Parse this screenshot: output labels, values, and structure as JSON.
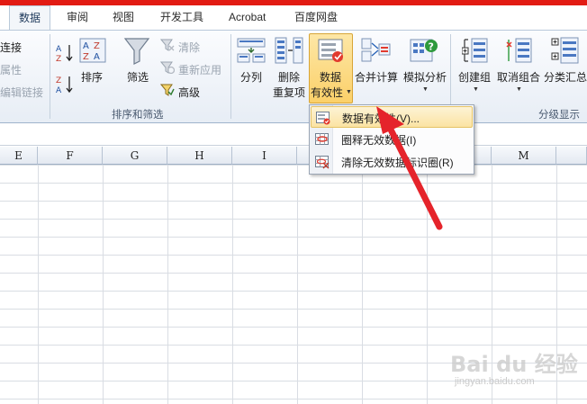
{
  "tabs": [
    {
      "label": "数据",
      "active": true
    },
    {
      "label": "审阅"
    },
    {
      "label": "视图"
    },
    {
      "label": "开发工具"
    },
    {
      "label": "Acrobat"
    },
    {
      "label": "百度网盘"
    }
  ],
  "ribbon": {
    "connections": {
      "connect": "连接",
      "properties": "属性",
      "edit_links": "编辑链接"
    },
    "sort_filter": {
      "sort": "排序",
      "filter": "筛选",
      "clear": "清除",
      "reapply": "重新应用",
      "advanced": "高级",
      "group_label": "排序和筛选"
    },
    "data_tools": {
      "text_to_columns": "分列",
      "remove_dup_1": "删除",
      "remove_dup_2": "重复项",
      "validation_1": "数据",
      "validation_2": "有效性",
      "consolidate": "合并计算",
      "what_if": "模拟分析"
    },
    "outline": {
      "group": "创建组",
      "ungroup": "取消组合",
      "subtotal": "分类汇总",
      "group_label": "分级显示"
    }
  },
  "columns": [
    "E",
    "F",
    "G",
    "H",
    "I",
    "",
    "",
    "L",
    "M"
  ],
  "menu": {
    "items": [
      {
        "label": "数据有效性(V)...",
        "hover": true,
        "icon": "data-validation-icon"
      },
      {
        "label": "圈释无效数据(I)",
        "icon": "circle-invalid-icon"
      },
      {
        "label": "清除无效数据标识圈(R)",
        "icon": "clear-circles-icon"
      }
    ]
  },
  "watermark": {
    "brand": "Bai du 经验",
    "url": "jingyan.baidu.com"
  },
  "colors": {
    "accent_red": "#e21b13",
    "highlight": "#fbd069",
    "arrow": "#e5242b"
  }
}
